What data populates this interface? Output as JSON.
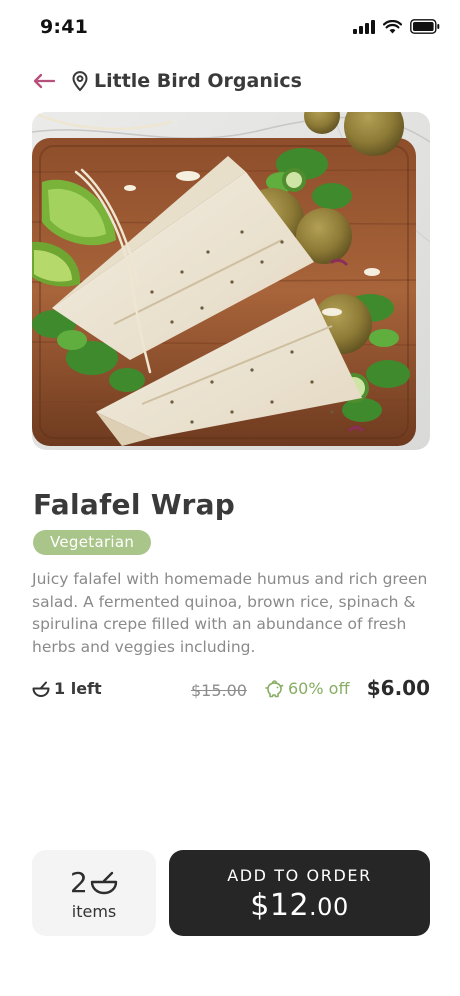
{
  "status_bar": {
    "time": "9:41"
  },
  "header": {
    "store_name": "Little Bird Organics"
  },
  "hero": {
    "image": "falafel wrap photo"
  },
  "product": {
    "title": "Falafel Wrap",
    "tag": "Vegetarian",
    "description": "Juicy falafel with homemade humus and rich green salad. A fermented quinoa, brown rice, spinach & spirulina crepe filled with an abundance of fresh herbs and veggies including.",
    "stock": "1 left",
    "original_price": "$15.00",
    "discount": "60% off",
    "price": "$6.00"
  },
  "order": {
    "count": "2",
    "count_label": "items",
    "button_label": "ADD TO ORDER",
    "total_dollars": "$12",
    "total_cents": ".00"
  },
  "colors": {
    "accent_pink": "#b5517a",
    "tag_green": "#a9c58a",
    "discount_green": "#86ad63",
    "button_dark": "#262626"
  }
}
